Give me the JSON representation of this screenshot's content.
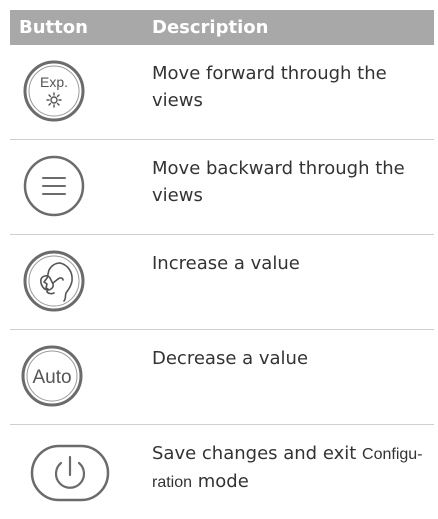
{
  "table": {
    "header": {
      "button": "Button",
      "description": "Description"
    },
    "rows": [
      {
        "icon": "exp-sun-icon",
        "icon_text": "Exp.",
        "description": "Move forward through the views"
      },
      {
        "icon": "menu-lines-icon",
        "description": "Move backward through the views"
      },
      {
        "icon": "patient-mask-icon",
        "description": "Increase a value"
      },
      {
        "icon": "auto-icon",
        "icon_text": "Auto",
        "description": "Decrease a value"
      },
      {
        "icon": "power-icon",
        "description_before": "Save changes and exit ",
        "description_keyword": "Configu-",
        "description_keyword_2": "ration",
        "description_after": " mode"
      }
    ]
  },
  "colors": {
    "header_bg": "#a8a8a8",
    "header_text": "#ffffff",
    "body_text": "#333333",
    "icon_stroke": "#6b6b6b",
    "divider": "#cfcfcf"
  }
}
